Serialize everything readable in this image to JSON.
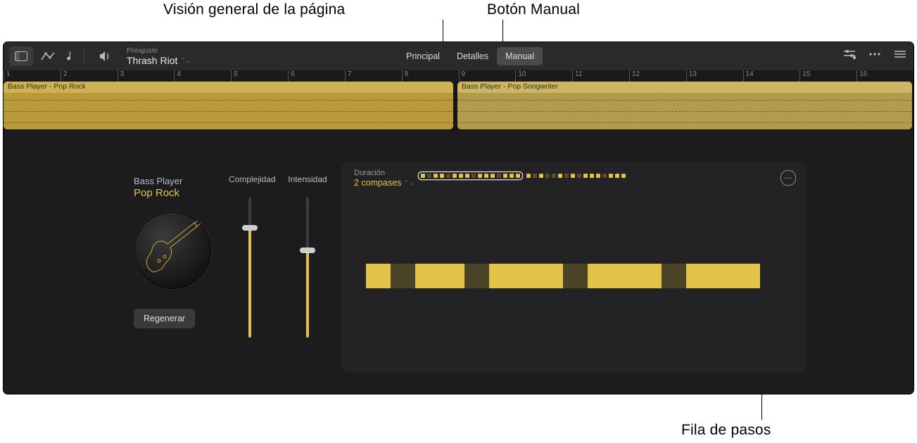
{
  "callouts": {
    "overview": "Visión general de la página",
    "manual_btn": "Botón Manual",
    "step_row": "Fila de pasos"
  },
  "toolbar": {
    "preset_label": "Preajuste",
    "preset_value": "Thrash Riot",
    "tabs": {
      "main": "Principal",
      "details": "Detalles",
      "manual": "Manual"
    }
  },
  "ruler": {
    "bars": [
      "1",
      "2",
      "3",
      "4",
      "5",
      "6",
      "7",
      "8",
      "9",
      "10",
      "11",
      "12",
      "13",
      "14",
      "15",
      "16"
    ]
  },
  "regions": {
    "a": "Bass Player - Pop Rock",
    "b": "Bass Player - Pop Songwriter"
  },
  "player": {
    "category": "Bass Player",
    "style": "Pop Rock",
    "regenerate": "Regenerar",
    "complexity_label": "Complejidad",
    "intensity_label": "Intensidad",
    "complexity_pct": 78,
    "intensity_pct": 62
  },
  "step_panel": {
    "duration_label": "Duración",
    "duration_value": "2 compases",
    "overview_pages": [
      [
        1,
        0,
        1,
        1,
        0,
        1,
        1,
        1,
        0,
        1,
        1,
        1,
        0,
        1,
        1,
        1
      ],
      [
        1,
        0,
        1,
        0,
        0,
        1,
        0,
        1,
        0,
        1,
        1,
        1,
        0,
        1,
        1,
        1
      ]
    ],
    "selected_page": 0,
    "steps": [
      1,
      0,
      1,
      1,
      0,
      1,
      1,
      1,
      0,
      1,
      1,
      1,
      0,
      1,
      1,
      1
    ]
  }
}
